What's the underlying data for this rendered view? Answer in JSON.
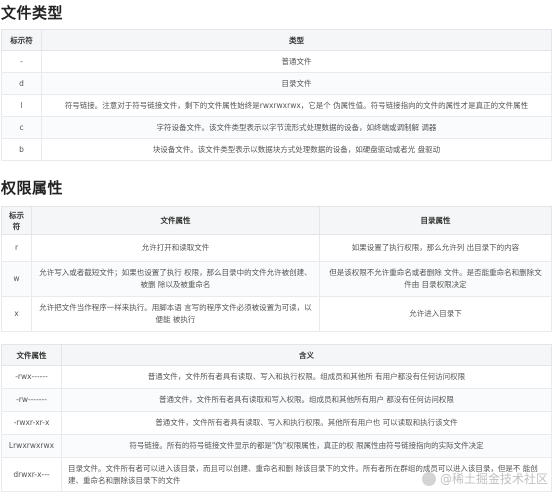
{
  "sections": {
    "file_types": {
      "heading": "文件类型",
      "headers": [
        "标示符",
        "类型"
      ],
      "rows": [
        [
          "-",
          "普通文件"
        ],
        [
          "d",
          "目录文件"
        ],
        [
          "l",
          "符号链接。注意对于符号链接文件，剩下的文件属性始终是rwxrwxrwx，它是个 伪属性值。符号链接指向的文件的属性才是真正的文件属性"
        ],
        [
          "c",
          "字符设备文件。该文件类型表示以字节流形式处理数据的设备，如终端或调制解 调器"
        ],
        [
          "b",
          "块设备文件。该文件类型表示以数据块方式处理数据的设备，如硬盘驱动或者光 盘驱动"
        ]
      ]
    },
    "permissions": {
      "heading": "权限属性",
      "headers": [
        "标示符",
        "文件属性",
        "目录属性"
      ],
      "rows": [
        [
          "r",
          "允许打开和读取文件",
          "如果设置了执行权限，那么允许列 出目录下的内容"
        ],
        [
          "w",
          "允许写入或者截短文件；如果也设置了执行 权限，那么目录中的文件允许被创建、被删 除以及被重命名",
          "但是该权限不允许重命名或者删除 文件。是否能重命名和删除文件由 目录权限决定"
        ],
        [
          "x",
          "允许把文件当作程序一样来执行。用脚本语 言写的程序文件必须被设置为可读，以便能 被执行",
          "允许进入目录下"
        ]
      ]
    },
    "file_attrs": {
      "headers": [
        "文件属性",
        "含义"
      ],
      "rows": [
        [
          "-rwx------",
          "普通文件，文件所有者具有读取、写入和执行权限。组成员和其他所 有用户都没有任何访问权限"
        ],
        [
          "-rw-------",
          "普通文件，文件所有者具有读取和写入权限。组成员和其他所有用户 都没有任何访问权限"
        ],
        [
          "-rwxr-xr-x",
          "普通文件，文件所有者具有读取、写入和执行权限。其他所有用户也 可以读取和执行该文件"
        ],
        [
          "Lrwxrwxrwx",
          "符号链接。所有的符号链接文件显示的都是\"伪\"权限属性，真正的权 限属性由符号链接指向的实际文件决定"
        ],
        [
          "drwxr-x---",
          "目录文件。文件所有者可以进入该目录，而且可以创建、重命名和删 除该目录下的文件。所有者所在群组的成员可以进入该目录，但是不 能创建、重命名和删除该目录下的文件"
        ]
      ]
    }
  },
  "watermark": "@稀土掘金技术社区"
}
